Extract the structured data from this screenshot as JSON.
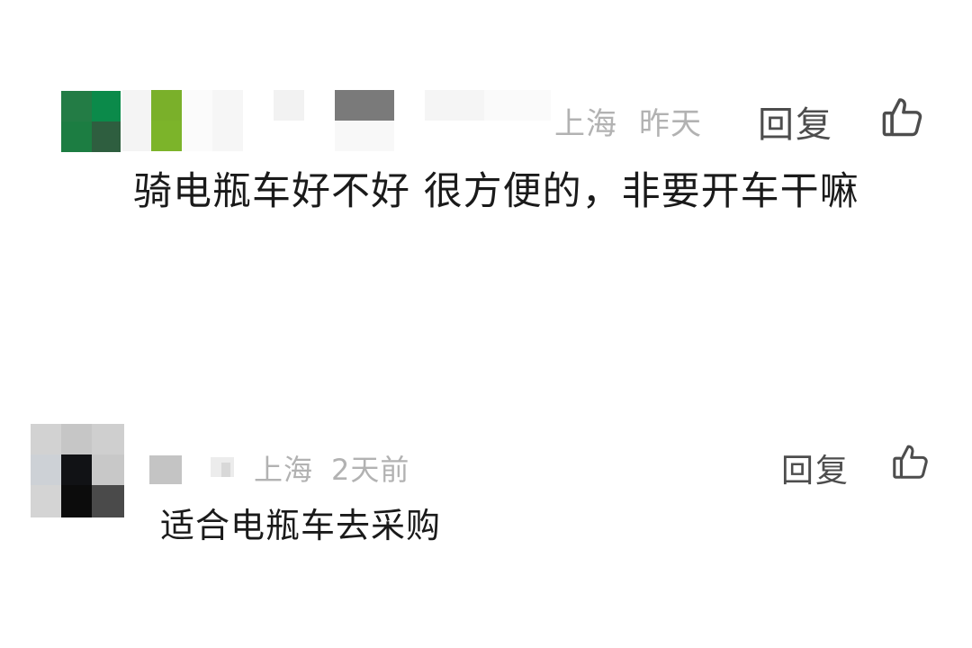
{
  "comments": [
    {
      "location": "上海",
      "time": "昨天",
      "reply_label": "回复",
      "text": "骑电瓶车好不好 很方便的，非要开车干嘛"
    },
    {
      "location": "上海",
      "time": "2天前",
      "reply_label": "回复",
      "text": "适合电瓶车去采购"
    }
  ],
  "icons": {
    "like": "thumbs-up-icon"
  },
  "colors": {
    "meta_text": "#b2b2b2",
    "reply_text": "#4d4d4d",
    "body_text": "#1a1a1a",
    "background": "#ffffff"
  }
}
